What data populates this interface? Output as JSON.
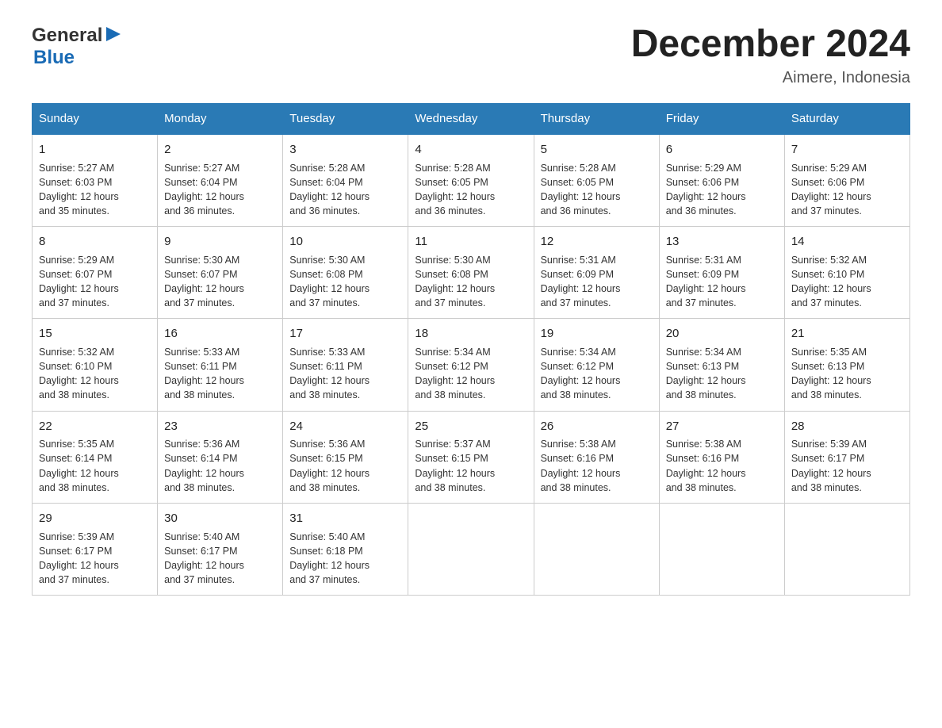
{
  "header": {
    "logo_general": "General",
    "logo_blue": "Blue",
    "month": "December 2024",
    "location": "Aimere, Indonesia"
  },
  "days_of_week": [
    "Sunday",
    "Monday",
    "Tuesday",
    "Wednesday",
    "Thursday",
    "Friday",
    "Saturday"
  ],
  "weeks": [
    [
      {
        "day": "1",
        "sunrise": "5:27 AM",
        "sunset": "6:03 PM",
        "daylight": "12 hours and 35 minutes."
      },
      {
        "day": "2",
        "sunrise": "5:27 AM",
        "sunset": "6:04 PM",
        "daylight": "12 hours and 36 minutes."
      },
      {
        "day": "3",
        "sunrise": "5:28 AM",
        "sunset": "6:04 PM",
        "daylight": "12 hours and 36 minutes."
      },
      {
        "day": "4",
        "sunrise": "5:28 AM",
        "sunset": "6:05 PM",
        "daylight": "12 hours and 36 minutes."
      },
      {
        "day": "5",
        "sunrise": "5:28 AM",
        "sunset": "6:05 PM",
        "daylight": "12 hours and 36 minutes."
      },
      {
        "day": "6",
        "sunrise": "5:29 AM",
        "sunset": "6:06 PM",
        "daylight": "12 hours and 36 minutes."
      },
      {
        "day": "7",
        "sunrise": "5:29 AM",
        "sunset": "6:06 PM",
        "daylight": "12 hours and 37 minutes."
      }
    ],
    [
      {
        "day": "8",
        "sunrise": "5:29 AM",
        "sunset": "6:07 PM",
        "daylight": "12 hours and 37 minutes."
      },
      {
        "day": "9",
        "sunrise": "5:30 AM",
        "sunset": "6:07 PM",
        "daylight": "12 hours and 37 minutes."
      },
      {
        "day": "10",
        "sunrise": "5:30 AM",
        "sunset": "6:08 PM",
        "daylight": "12 hours and 37 minutes."
      },
      {
        "day": "11",
        "sunrise": "5:30 AM",
        "sunset": "6:08 PM",
        "daylight": "12 hours and 37 minutes."
      },
      {
        "day": "12",
        "sunrise": "5:31 AM",
        "sunset": "6:09 PM",
        "daylight": "12 hours and 37 minutes."
      },
      {
        "day": "13",
        "sunrise": "5:31 AM",
        "sunset": "6:09 PM",
        "daylight": "12 hours and 37 minutes."
      },
      {
        "day": "14",
        "sunrise": "5:32 AM",
        "sunset": "6:10 PM",
        "daylight": "12 hours and 37 minutes."
      }
    ],
    [
      {
        "day": "15",
        "sunrise": "5:32 AM",
        "sunset": "6:10 PM",
        "daylight": "12 hours and 38 minutes."
      },
      {
        "day": "16",
        "sunrise": "5:33 AM",
        "sunset": "6:11 PM",
        "daylight": "12 hours and 38 minutes."
      },
      {
        "day": "17",
        "sunrise": "5:33 AM",
        "sunset": "6:11 PM",
        "daylight": "12 hours and 38 minutes."
      },
      {
        "day": "18",
        "sunrise": "5:34 AM",
        "sunset": "6:12 PM",
        "daylight": "12 hours and 38 minutes."
      },
      {
        "day": "19",
        "sunrise": "5:34 AM",
        "sunset": "6:12 PM",
        "daylight": "12 hours and 38 minutes."
      },
      {
        "day": "20",
        "sunrise": "5:34 AM",
        "sunset": "6:13 PM",
        "daylight": "12 hours and 38 minutes."
      },
      {
        "day": "21",
        "sunrise": "5:35 AM",
        "sunset": "6:13 PM",
        "daylight": "12 hours and 38 minutes."
      }
    ],
    [
      {
        "day": "22",
        "sunrise": "5:35 AM",
        "sunset": "6:14 PM",
        "daylight": "12 hours and 38 minutes."
      },
      {
        "day": "23",
        "sunrise": "5:36 AM",
        "sunset": "6:14 PM",
        "daylight": "12 hours and 38 minutes."
      },
      {
        "day": "24",
        "sunrise": "5:36 AM",
        "sunset": "6:15 PM",
        "daylight": "12 hours and 38 minutes."
      },
      {
        "day": "25",
        "sunrise": "5:37 AM",
        "sunset": "6:15 PM",
        "daylight": "12 hours and 38 minutes."
      },
      {
        "day": "26",
        "sunrise": "5:38 AM",
        "sunset": "6:16 PM",
        "daylight": "12 hours and 38 minutes."
      },
      {
        "day": "27",
        "sunrise": "5:38 AM",
        "sunset": "6:16 PM",
        "daylight": "12 hours and 38 minutes."
      },
      {
        "day": "28",
        "sunrise": "5:39 AM",
        "sunset": "6:17 PM",
        "daylight": "12 hours and 38 minutes."
      }
    ],
    [
      {
        "day": "29",
        "sunrise": "5:39 AM",
        "sunset": "6:17 PM",
        "daylight": "12 hours and 37 minutes."
      },
      {
        "day": "30",
        "sunrise": "5:40 AM",
        "sunset": "6:17 PM",
        "daylight": "12 hours and 37 minutes."
      },
      {
        "day": "31",
        "sunrise": "5:40 AM",
        "sunset": "6:18 PM",
        "daylight": "12 hours and 37 minutes."
      },
      null,
      null,
      null,
      null
    ]
  ],
  "labels": {
    "sunrise": "Sunrise:",
    "sunset": "Sunset:",
    "daylight": "Daylight:"
  }
}
